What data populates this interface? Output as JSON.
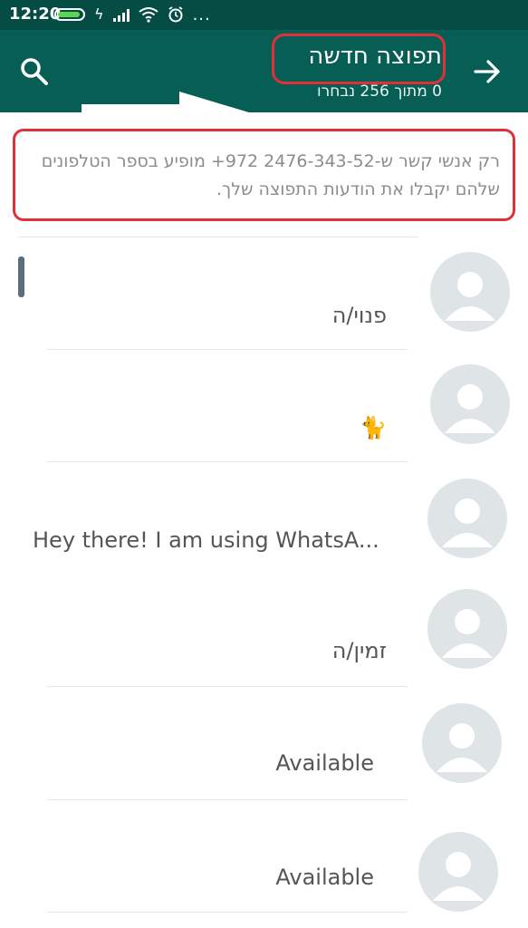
{
  "status_bar": {
    "time": "12:20",
    "dots": "...",
    "icons": [
      "battery-icon",
      "charging-icon",
      "signal-icon",
      "wifi-icon",
      "alarm-icon"
    ]
  },
  "toolbar": {
    "title": "תפוצה חדשה",
    "subtitle": "0 מתוך 256 נבחרו",
    "search_icon": "search-icon",
    "back_icon": "arrow-right-icon"
  },
  "info": {
    "text": "רק אנשי קשר ש-2476-343-52 972+ מופיע בספר הטלפונים שלהם יקבלו את הודעות התפוצה שלך."
  },
  "contacts": [
    {
      "status": "פנוי/ה"
    },
    {
      "status": "🐈"
    },
    {
      "status": "Hey there! I am using WhatsA..."
    },
    {
      "status": "זמין/ה"
    },
    {
      "status": "Available"
    },
    {
      "status": "Available"
    }
  ],
  "colors": {
    "status_bar": "#054d44",
    "toolbar": "#075e54",
    "highlight": "#e03039",
    "avatar_bg": "#dfe5e7"
  }
}
